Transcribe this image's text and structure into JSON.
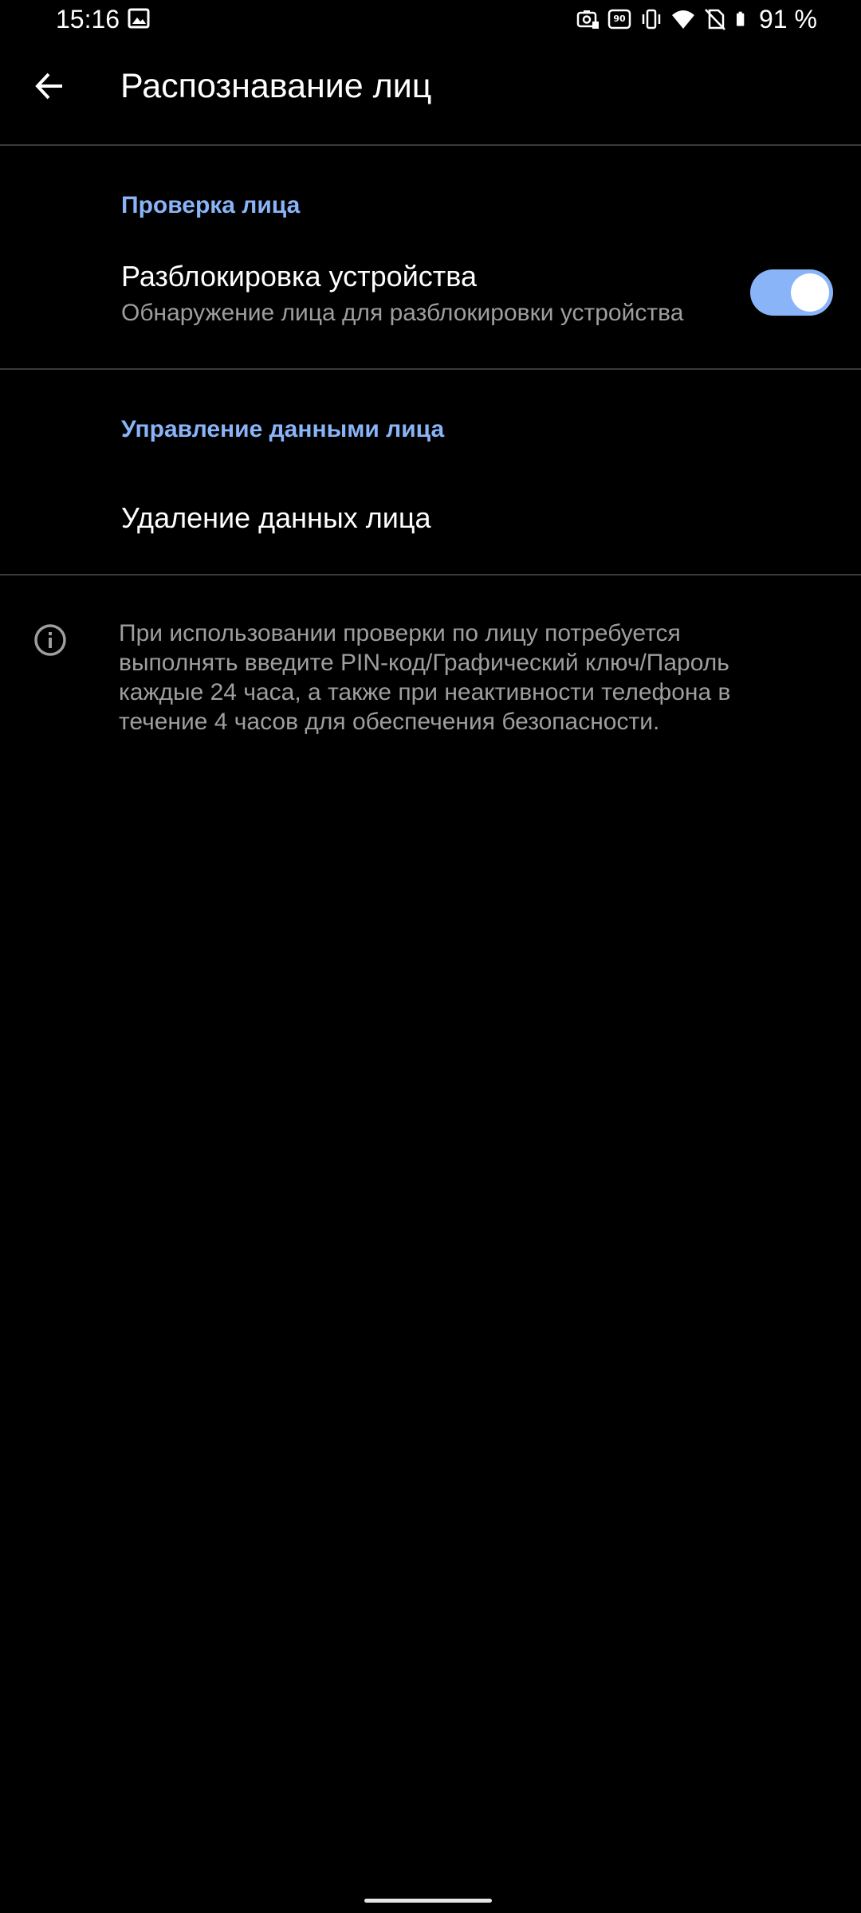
{
  "status_bar": {
    "time": "15:16",
    "battery_percent": "91 %",
    "icons": [
      "gallery-icon",
      "screen-record-icon",
      "refresh-rate-90hz-icon",
      "vibrate-icon",
      "wifi-icon",
      "no-sim-icon",
      "battery-icon"
    ]
  },
  "app_bar": {
    "title": "Распознавание лиц",
    "back_icon": "arrow-back-icon"
  },
  "sections": {
    "face_check": {
      "header": "Проверка лица",
      "unlock": {
        "title": "Разблокировка устройства",
        "summary": "Обнаружение лица для разблокировки устройства",
        "enabled": true
      }
    },
    "face_data": {
      "header": "Управление данными лица",
      "delete": {
        "title": "Удаление данных лица"
      }
    }
  },
  "info": {
    "icon": "info-icon",
    "text": "При использовании проверки по лицу потребуется выполнять введите PIN-код/Графический ключ/Пароль каждые 24 часа, а также при неактивности телефона в течение 4 часов для обеспечения безопасности."
  },
  "colors": {
    "accent": "#8ab4f8",
    "background": "#000000",
    "secondary_text": "#9e9e9e"
  }
}
